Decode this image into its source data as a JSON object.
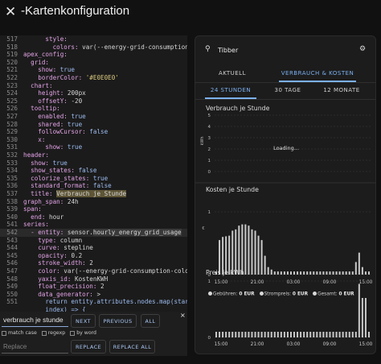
{
  "header": {
    "close_glyph": "✕",
    "title": "-Kartenkonfiguration"
  },
  "editor": {
    "lines": [
      {
        "num": "517",
        "parts": [
          {
            "t": "      style:",
            "c": "k"
          }
        ]
      },
      {
        "num": "518",
        "parts": [
          {
            "t": "        colors: ",
            "c": "k"
          },
          {
            "t": "var(--energy-grid-consumption-",
            "c": ""
          }
        ]
      },
      {
        "num": "519",
        "parts": [
          {
            "t": "apex_config:",
            "c": "k"
          }
        ]
      },
      {
        "num": "520",
        "parts": [
          {
            "t": "  grid:",
            "c": "k"
          }
        ]
      },
      {
        "num": "521",
        "parts": [
          {
            "t": "    show: ",
            "c": "k"
          },
          {
            "t": "true",
            "c": "v"
          }
        ]
      },
      {
        "num": "522",
        "parts": [
          {
            "t": "    borderColor: ",
            "c": "k"
          },
          {
            "t": "'#E0E0E0'",
            "c": "s"
          }
        ]
      },
      {
        "num": "523",
        "parts": [
          {
            "t": "  chart:",
            "c": "k"
          }
        ]
      },
      {
        "num": "524",
        "parts": [
          {
            "t": "    height: ",
            "c": "k"
          },
          {
            "t": "200px",
            "c": ""
          }
        ]
      },
      {
        "num": "525",
        "parts": [
          {
            "t": "    offsetY: ",
            "c": "k"
          },
          {
            "t": "-20",
            "c": ""
          }
        ]
      },
      {
        "num": "526",
        "parts": [
          {
            "t": "  tooltip:",
            "c": "k"
          }
        ]
      },
      {
        "num": "527",
        "parts": [
          {
            "t": "    enabled: ",
            "c": "k"
          },
          {
            "t": "true",
            "c": "v"
          }
        ]
      },
      {
        "num": "528",
        "parts": [
          {
            "t": "    shared: ",
            "c": "k"
          },
          {
            "t": "true",
            "c": "v"
          }
        ]
      },
      {
        "num": "529",
        "parts": [
          {
            "t": "    followCursor: ",
            "c": "k"
          },
          {
            "t": "false",
            "c": "v"
          }
        ]
      },
      {
        "num": "530",
        "parts": [
          {
            "t": "    x:",
            "c": "k"
          }
        ]
      },
      {
        "num": "531",
        "parts": [
          {
            "t": "      show: ",
            "c": "k"
          },
          {
            "t": "true",
            "c": "v"
          }
        ]
      },
      {
        "num": "532",
        "parts": [
          {
            "t": "header:",
            "c": "k"
          }
        ]
      },
      {
        "num": "533",
        "parts": [
          {
            "t": "  show: ",
            "c": "k"
          },
          {
            "t": "true",
            "c": "v"
          }
        ]
      },
      {
        "num": "534",
        "parts": [
          {
            "t": "  show_states: ",
            "c": "k"
          },
          {
            "t": "false",
            "c": "v"
          }
        ]
      },
      {
        "num": "535",
        "parts": [
          {
            "t": "  colorize_states: ",
            "c": "k"
          },
          {
            "t": "true",
            "c": "v"
          }
        ]
      },
      {
        "num": "536",
        "parts": [
          {
            "t": "  standard_format: ",
            "c": "k"
          },
          {
            "t": "false",
            "c": "v"
          }
        ]
      },
      {
        "num": "537",
        "parts": [
          {
            "t": "  title: ",
            "c": "k"
          },
          {
            "t": "Verbrauch je Stunde",
            "c": "hl"
          }
        ]
      },
      {
        "num": "538",
        "parts": [
          {
            "t": "graph_span: ",
            "c": "k"
          },
          {
            "t": "24h",
            "c": ""
          }
        ]
      },
      {
        "num": "539",
        "parts": [
          {
            "t": "span:",
            "c": "k"
          }
        ]
      },
      {
        "num": "540",
        "parts": [
          {
            "t": "  end: ",
            "c": "k"
          },
          {
            "t": "hour",
            "c": ""
          }
        ]
      },
      {
        "num": "541",
        "parts": [
          {
            "t": "series:",
            "c": "k"
          }
        ]
      },
      {
        "num": "542",
        "parts": [
          {
            "t": "  - entity: ",
            "c": "k"
          },
          {
            "t": "sensor.",
            "c": ""
          },
          {
            "t": "hourly_energy_grid_usage",
            "c": "hlw"
          }
        ],
        "active": true
      },
      {
        "num": "543",
        "parts": [
          {
            "t": "    type: ",
            "c": "k"
          },
          {
            "t": "column",
            "c": ""
          }
        ]
      },
      {
        "num": "544",
        "parts": [
          {
            "t": "    curve: ",
            "c": "k"
          },
          {
            "t": "stepline",
            "c": ""
          }
        ]
      },
      {
        "num": "545",
        "parts": [
          {
            "t": "    opacity: ",
            "c": "k"
          },
          {
            "t": "0.2",
            "c": ""
          }
        ]
      },
      {
        "num": "546",
        "parts": [
          {
            "t": "    stroke_width: ",
            "c": "k"
          },
          {
            "t": "2",
            "c": ""
          }
        ]
      },
      {
        "num": "547",
        "parts": [
          {
            "t": "    color: ",
            "c": "k"
          },
          {
            "t": "var(--energy-grid-consumption-color)",
            "c": ""
          }
        ]
      },
      {
        "num": "548",
        "parts": [
          {
            "t": "    yaxis_id: ",
            "c": "k"
          },
          {
            "t": "KostenKWH",
            "c": ""
          }
        ]
      },
      {
        "num": "549",
        "parts": [
          {
            "t": "    float_precision: ",
            "c": "k"
          },
          {
            "t": "2",
            "c": ""
          }
        ]
      },
      {
        "num": "550",
        "parts": [
          {
            "t": "    data_generator: ",
            "c": "k"
          },
          {
            "t": ">",
            "c": ""
          }
        ]
      },
      {
        "num": "551",
        "parts": [
          {
            "t": "      return entity.attributes.nodes.map(start,",
            "c": "v"
          }
        ]
      },
      {
        "num": "   ",
        "parts": [
          {
            "t": "      index) => {",
            "c": "v"
          }
        ]
      },
      {
        "num": "552",
        "parts": [
          {
            "t": "        return [new Date(start[\"from\"]).getTime(",
            "c": "v"
          }
        ]
      }
    ]
  },
  "find": {
    "query": "verbrauch je stunde",
    "next_label": "NEXT",
    "previous_label": "PREVIOUS",
    "all_label": "ALL",
    "close_glyph": "×",
    "match_case_label": "match case",
    "regexp_label": "regexp",
    "by_word_label": "by word",
    "replace_placeholder": "Replace",
    "replace_label": "REPLACE",
    "replace_all_label": "REPLACE ALL"
  },
  "card": {
    "icon_glyph": "⚲",
    "title": "Tibber",
    "gear_glyph": "⚙",
    "tabs": [
      {
        "label": "AKTUELL",
        "active": false
      },
      {
        "label": "VERBRAUCH & KOSTEN",
        "active": true
      }
    ],
    "subtabs": [
      {
        "label": "24 STUNDEN",
        "active": true
      },
      {
        "label": "30 TAGE",
        "active": false
      },
      {
        "label": "12 MONATE",
        "active": false
      }
    ],
    "loading_text": "Loading...",
    "colors": {
      "accent": "#7bb0f0",
      "bar": "#e6e6e6",
      "grid": "#3a3a3a"
    }
  },
  "chart_data": [
    {
      "type": "bar",
      "title": "Verbrauch je Stunde",
      "ylabel": "kWh",
      "yticks": [
        "5",
        "4",
        "3",
        "2",
        "1",
        "0"
      ],
      "ylim": [
        0,
        5
      ],
      "categories": [],
      "values": [],
      "grid": true
    },
    {
      "type": "bar",
      "title": "Kosten je Stunde",
      "ylabel": "€",
      "yticks": [
        "1",
        "0"
      ],
      "xticks": [
        "15:00",
        "21:00",
        "03:00",
        "09:00",
        "15:00"
      ],
      "ylim": [
        0,
        1
      ],
      "values": [
        0.05,
        0.55,
        0.6,
        0.61,
        0.62,
        0.7,
        0.72,
        0.78,
        0.8,
        0.8,
        0.78,
        0.72,
        0.7,
        0.62,
        0.55,
        0.3,
        0.12,
        0.08,
        0.05,
        0.05,
        0.05,
        0.05,
        0.05,
        0.05,
        0.05,
        0.05,
        0.05,
        0.05,
        0.05,
        0.05,
        0.05,
        0.05,
        0.05,
        0.05,
        0.05,
        0.05,
        0.05,
        0.05,
        0.05,
        0.05,
        0.05,
        0.05,
        0.05,
        0.2,
        0.35,
        0.12,
        0.05,
        0.05
      ],
      "legend": [
        {
          "name": "Gebühren:",
          "value": "0 EUR"
        },
        {
          "name": "Strompreis:",
          "value": "0 EUR"
        },
        {
          "name": "Gesamt:",
          "value": "0 EUR"
        }
      ],
      "grid": true
    },
    {
      "type": "bar",
      "title": "Preis je kWh",
      "yticks": [
        "1",
        "0"
      ],
      "xticks": [
        "15:00",
        "21:00",
        "03:00",
        "09:00",
        "15:00"
      ],
      "ylim": [
        0,
        1
      ],
      "values": [
        0.1,
        0.1,
        0.1,
        0.1,
        0.1,
        0.1,
        0.1,
        0.1,
        0.1,
        0.1,
        0.1,
        0.1,
        0.1,
        0.1,
        0.1,
        0.1,
        0.1,
        0.1,
        0.1,
        0.1,
        0.1,
        0.1,
        0.1,
        0.1,
        0.1,
        0.1,
        0.1,
        0.1,
        0.1,
        0.1,
        0.1,
        0.1,
        0.1,
        0.1,
        0.1,
        0.1,
        0.1,
        0.1,
        0.1,
        0.1,
        0.1,
        0.1,
        0.1,
        0.1,
        0.95,
        0.7,
        0.7,
        0.1
      ],
      "grid": true
    }
  ]
}
